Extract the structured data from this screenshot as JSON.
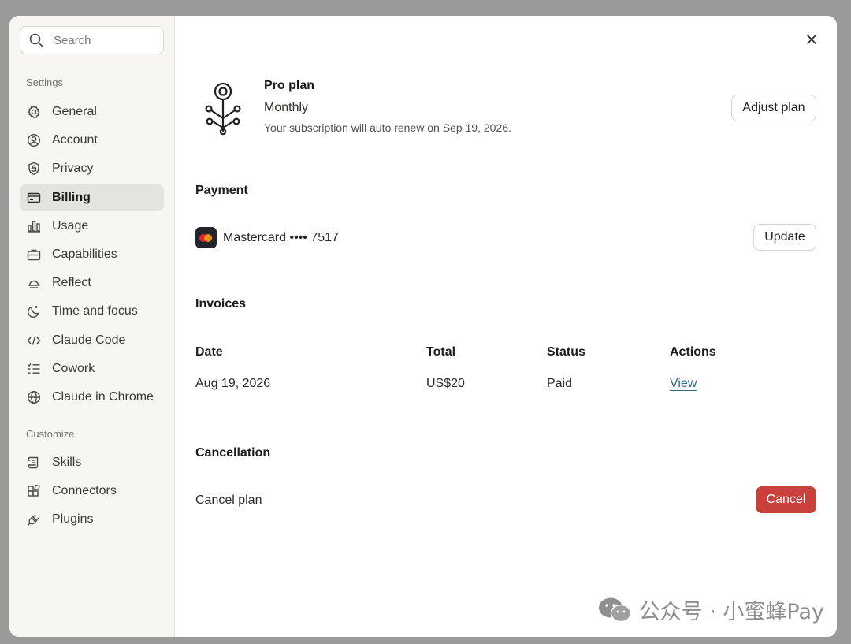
{
  "search": {
    "placeholder": "Search"
  },
  "sidebar": {
    "settings_label": "Settings",
    "settings_items": [
      {
        "label": "General",
        "icon": "gear-icon"
      },
      {
        "label": "Account",
        "icon": "user-circle-icon"
      },
      {
        "label": "Privacy",
        "icon": "shield-lock-icon"
      },
      {
        "label": "Billing",
        "icon": "credit-card-icon",
        "active": true
      },
      {
        "label": "Usage",
        "icon": "bar-chart-icon"
      },
      {
        "label": "Capabilities",
        "icon": "briefcase-icon"
      },
      {
        "label": "Reflect",
        "icon": "sunset-icon"
      },
      {
        "label": "Time and focus",
        "icon": "moon-icon"
      },
      {
        "label": "Claude Code",
        "icon": "code-icon"
      },
      {
        "label": "Cowork",
        "icon": "checklist-icon"
      },
      {
        "label": "Claude in Chrome",
        "icon": "globe-icon"
      }
    ],
    "customize_label": "Customize",
    "customize_items": [
      {
        "label": "Skills",
        "icon": "scroll-icon"
      },
      {
        "label": "Connectors",
        "icon": "blocks-icon"
      },
      {
        "label": "Plugins",
        "icon": "plug-icon"
      }
    ]
  },
  "plan": {
    "title": "Pro plan",
    "period": "Monthly",
    "renewal": "Your subscription will auto renew on Sep 19, 2026.",
    "adjust_label": "Adjust plan"
  },
  "payment": {
    "heading": "Payment",
    "card_text": "Mastercard •••• 7517",
    "update_label": "Update"
  },
  "invoices": {
    "heading": "Invoices",
    "columns": [
      "Date",
      "Total",
      "Status",
      "Actions"
    ],
    "rows": [
      {
        "date": "Aug 19, 2026",
        "total": "US$20",
        "status": "Paid",
        "action": "View"
      }
    ]
  },
  "cancellation": {
    "heading": "Cancellation",
    "label": "Cancel plan",
    "button_label": "Cancel"
  },
  "watermark": {
    "text": "公众号 · 小蜜蜂Pay"
  },
  "colors": {
    "accent_danger": "#c8413a",
    "link": "#2f6b82",
    "sidebar_bg": "#f7f6f3",
    "active_bg": "#e5e3de"
  }
}
